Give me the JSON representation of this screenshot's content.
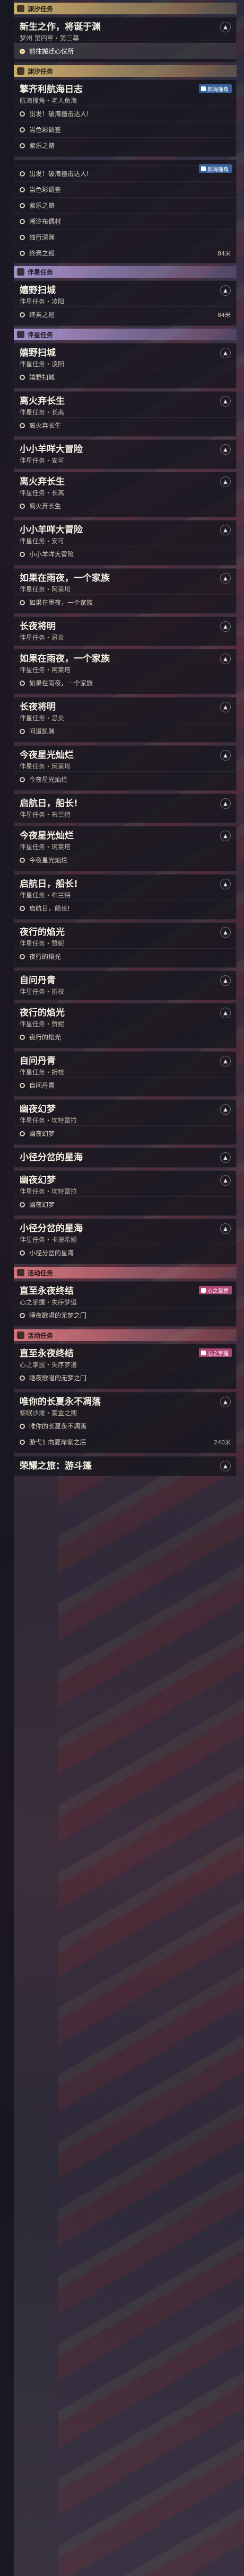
{
  "groups": [
    {
      "category": "渊汐任务",
      "style": "gold",
      "cards": [
        {
          "title": "新生之作，将诞于渊",
          "subtitle": "梦州 第四章・第三幕",
          "steps": [
            {
              "label": "前往搬迁心仪所",
              "active": true
            }
          ]
        }
      ]
    },
    {
      "category": "渊汐任务",
      "style": "gold",
      "cards": [
        {
          "title": "擎齐利航海日志",
          "subtitle": "航海撞角・老人鱼海",
          "tag": "航海撞角",
          "steps": [
            {
              "label": "出发！破海撞击达人!"
            },
            {
              "label": "当色彩调查"
            },
            {
              "label": "紫乐之赂"
            }
          ]
        }
      ]
    },
    {
      "category": "",
      "style": "",
      "cards": [
        {
          "title": "",
          "subtitle": "",
          "tag": "航海撞角",
          "steps": [
            {
              "label": "出发！破海撞击达人!"
            },
            {
              "label": "当色彩调查"
            },
            {
              "label": "紫乐之赂"
            },
            {
              "label": "潮汐布偶村"
            },
            {
              "label": "独行深渊"
            },
            {
              "label": "终焉之巡",
              "distance": "84米"
            }
          ]
        }
      ]
    },
    {
      "category": "伴星任务",
      "style": "purple",
      "cards": [
        {
          "title": "嬉野扫城",
          "subtitle": "伴星任务・凌阳",
          "steps": [
            {
              "label": "终焉之巡",
              "distance": "84米"
            }
          ]
        }
      ]
    },
    {
      "category": "伴星任务",
      "style": "purple",
      "cards": [
        {
          "title": "嬉野扫城",
          "subtitle": "伴星任务・凌阳",
          "steps": [
            {
              "label": "嬉野扫城"
            }
          ]
        },
        {
          "title": "离火弃长生",
          "subtitle": "伴星任务・长离",
          "steps": [
            {
              "label": "离火弃长生"
            }
          ]
        },
        {
          "title": "小小羊咩大冒险",
          "subtitle": "伴星任务・安可",
          "steps": []
        },
        {
          "title": "离火弃长生",
          "subtitle": "伴星任务・长离",
          "steps": [
            {
              "label": "离火弃长生"
            }
          ]
        },
        {
          "title": "小小羊咩大冒险",
          "subtitle": "伴星任务・安可",
          "steps": [
            {
              "label": "小小羊咩大冒险"
            }
          ]
        },
        {
          "title": "如果在雨夜，一个家族",
          "subtitle": "伴星任务・阿莱塔",
          "steps": [
            {
              "label": "如果在雨夜，一个家族"
            }
          ]
        },
        {
          "title": "长夜将明",
          "subtitle": "伴星任务・忌炎",
          "steps": []
        },
        {
          "title": "如果在雨夜，一个家族",
          "subtitle": "伴星任务・阿莱塔",
          "steps": [
            {
              "label": "如果在雨夜，一个家族"
            }
          ]
        },
        {
          "title": "长夜将明",
          "subtitle": "伴星任务・忌炎",
          "steps": [
            {
              "label": "问道凯渊"
            }
          ]
        },
        {
          "title": "今夜星光灿烂",
          "subtitle": "伴星任务・珂莱塔",
          "steps": [
            {
              "label": "今夜星光灿烂"
            }
          ]
        },
        {
          "title": "启航日，船长!",
          "subtitle": "伴星任务・布兰特",
          "steps": []
        },
        {
          "title": "今夜星光灿烂",
          "subtitle": "伴星任务・珂莱塔",
          "steps": [
            {
              "label": "今夜星光灿烂"
            }
          ]
        },
        {
          "title": "启航日，船长!",
          "subtitle": "伴星任务・布兰特",
          "steps": [
            {
              "label": "启航日，船长!"
            }
          ]
        },
        {
          "title": "夜行的焰光",
          "subtitle": "伴星任务・赞妮",
          "steps": [
            {
              "label": "夜行的焰光"
            }
          ]
        },
        {
          "title": "自问丹青",
          "subtitle": "伴星任务・折枝",
          "steps": []
        },
        {
          "title": "夜行的焰光",
          "subtitle": "伴星任务・赞妮",
          "steps": [
            {
              "label": "夜行的焰光"
            }
          ]
        },
        {
          "title": "自问丹青",
          "subtitle": "伴星任务・折枝",
          "steps": [
            {
              "label": "自问丹青"
            }
          ]
        },
        {
          "title": "幽夜幻梦",
          "subtitle": "伴星任务・坎特蕾拉",
          "steps": [
            {
              "label": "幽夜幻梦"
            }
          ]
        },
        {
          "title": "小径分岔的星海",
          "subtitle": "",
          "steps": []
        },
        {
          "title": "幽夜幻梦",
          "subtitle": "伴星任务・坎特蕾拉",
          "steps": [
            {
              "label": "幽夜幻梦"
            }
          ]
        },
        {
          "title": "小径分岔的星海",
          "subtitle": "伴星任务・卡提希娅",
          "steps": [
            {
              "label": "小径分岔的星海"
            }
          ]
        }
      ]
    },
    {
      "category": "活动任务",
      "style": "red",
      "cards": [
        {
          "title": "直至永夜终结",
          "subtitle": "心之掌握・失序梦道",
          "tag": "心之掌握",
          "tagStyle": "pink",
          "steps": [
            {
              "label": "睡夜歌唱的无梦之门"
            }
          ]
        }
      ]
    },
    {
      "category": "活动任务",
      "style": "red",
      "cards": [
        {
          "title": "直至永夜终结",
          "subtitle": "心之掌握・失序梦道",
          "tag": "心之掌握",
          "tagStyle": "pink",
          "steps": [
            {
              "label": "睡夜歌唱的无梦之门"
            }
          ]
        },
        {
          "title": "唯你的长夏永不凋落",
          "subtitle": "黎眠沙滩・雾盒之期",
          "steps": [
            {
              "label": "唯你的长夏永不凋落"
            },
            {
              "label": "游弋1 向夏岸紫之后",
              "distance": "240米"
            }
          ]
        },
        {
          "title": "荣耀之旅：游斗篷",
          "subtitle": "",
          "steps": []
        }
      ]
    }
  ],
  "colors": {
    "gold": "#d4b46e",
    "purple": "#aa96d2",
    "red": "#dc7882",
    "tag_blue": "#3c6eb4",
    "tag_pink": "#c85082"
  }
}
